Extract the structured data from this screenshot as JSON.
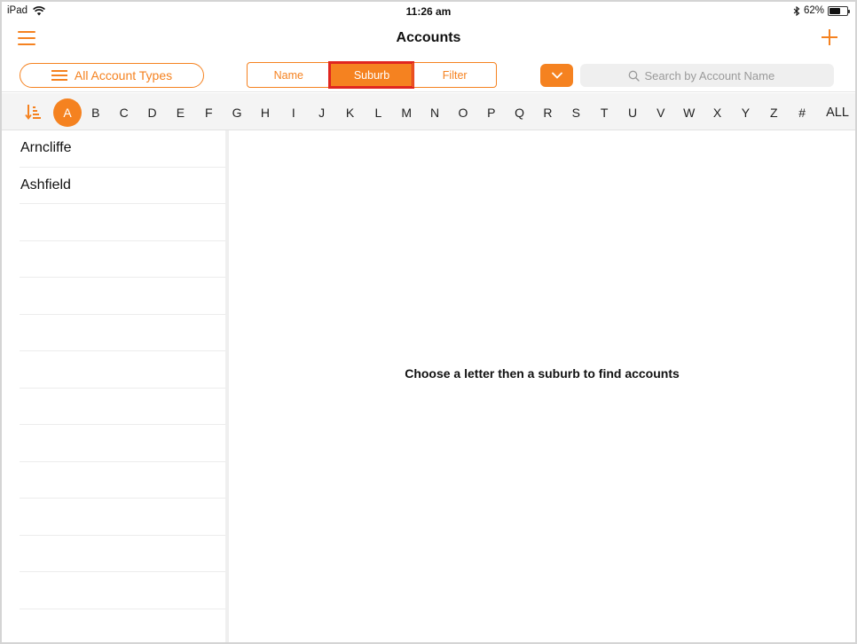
{
  "status_bar": {
    "device": "iPad",
    "time": "11:26 am",
    "battery_text": "62%",
    "battery_level": 0.62
  },
  "nav": {
    "title": "Accounts",
    "menu_icon": "hamburger-menu-icon",
    "add_icon": "plus-icon"
  },
  "toolbar": {
    "account_types_label": "All Account Types",
    "segments": [
      "Name",
      "Suburb",
      "Filter"
    ],
    "active_segment": "Suburb",
    "search_placeholder": "Search by Account Name"
  },
  "alphabet": {
    "letters": [
      "A",
      "B",
      "C",
      "D",
      "E",
      "F",
      "G",
      "H",
      "I",
      "J",
      "K",
      "L",
      "M",
      "N",
      "O",
      "P",
      "Q",
      "R",
      "S",
      "T",
      "U",
      "V",
      "W",
      "X",
      "Y",
      "Z",
      "#",
      "ALL"
    ],
    "active": "A"
  },
  "suburbs": [
    "Arncliffe",
    "Ashfield",
    "",
    "",
    "",
    "",
    "",
    "",
    "",
    "",
    "",
    "",
    "",
    ""
  ],
  "detail": {
    "hint": "Choose a letter then a suburb to find accounts"
  },
  "colors": {
    "accent": "#f58220",
    "highlight": "#e0261f"
  }
}
